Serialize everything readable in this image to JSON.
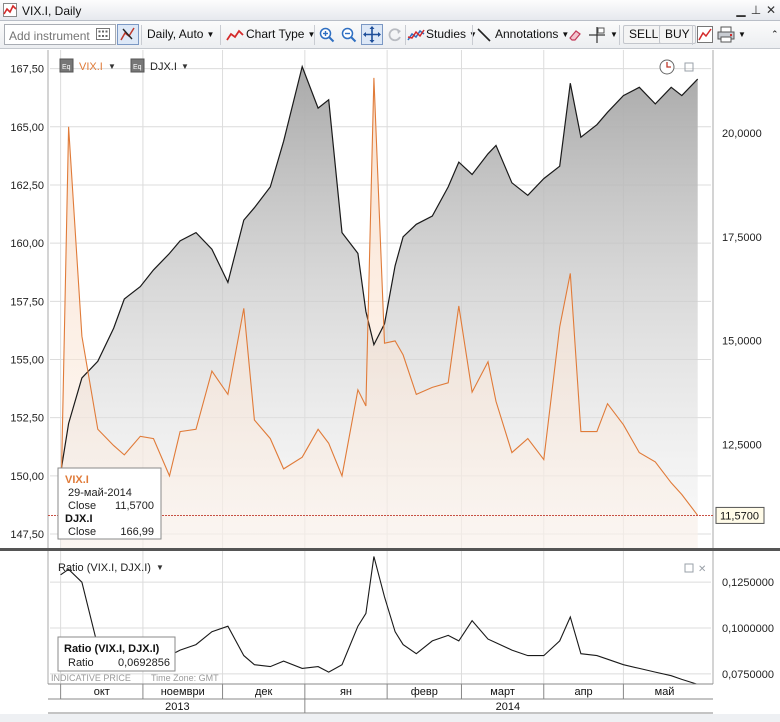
{
  "window": {
    "title": "VIX.I, Daily"
  },
  "toolbar": {
    "add_instrument_placeholder": "Add instrument",
    "period_label": "Daily,",
    "scale_label": "Auto",
    "chart_type_label": "Chart Type",
    "studies_label": "Studies",
    "annotations_label": "Annotations",
    "sell_label": "SELL",
    "buy_label": "BUY"
  },
  "legend": {
    "vix_label": "VIX.I",
    "djx_label": "DJX.I"
  },
  "tooltip": {
    "vix_title": "VIX.I",
    "date": "29-май-2014",
    "vix_close_label": "Close",
    "vix_close_value": "11,5700",
    "djx_title": "DJX.I",
    "djx_close_label": "Close",
    "djx_close_value": "166,99"
  },
  "price_marker": "11,5700",
  "lower_panel": {
    "title": "Ratio (VIX.I, DJX.I)",
    "tooltip_title": "Ratio (VIX.I, DJX.I)",
    "tooltip_label": "Ratio",
    "tooltip_value": "0,0692856",
    "indicative": "INDICATIVE PRICE",
    "timezone": "Time Zone: GMT"
  },
  "colors": {
    "vix": "#e07b39",
    "djx": "#1a1a1a",
    "ratio": "#1a1a1a",
    "background": "#ffffff"
  },
  "chart_data": {
    "type": "line",
    "x": [
      "2013-10-01",
      "2013-10-04",
      "2013-10-09",
      "2013-10-15",
      "2013-10-21",
      "2013-10-25",
      "2013-10-31",
      "2013-11-05",
      "2013-11-11",
      "2013-11-15",
      "2013-11-21",
      "2013-11-27",
      "2013-12-03",
      "2013-12-09",
      "2013-12-13",
      "2013-12-19",
      "2013-12-24",
      "2013-12-31",
      "2014-01-06",
      "2014-01-10",
      "2014-01-15",
      "2014-01-21",
      "2014-01-24",
      "2014-01-27",
      "2014-01-31",
      "2014-02-04",
      "2014-02-07",
      "2014-02-12",
      "2014-02-18",
      "2014-02-24",
      "2014-02-28",
      "2014-03-05",
      "2014-03-11",
      "2014-03-14",
      "2014-03-20",
      "2014-03-26",
      "2014-04-01",
      "2014-04-07",
      "2014-04-11",
      "2014-04-15",
      "2014-04-21",
      "2014-04-25",
      "2014-05-01",
      "2014-05-07",
      "2014-05-13",
      "2014-05-19",
      "2014-05-23",
      "2014-05-29"
    ],
    "series": [
      {
        "name": "VIX.I",
        "axis": "left",
        "values": [
          148.2,
          165.0,
          156.0,
          152.0,
          151.3,
          150.9,
          151.7,
          151.6,
          150.0,
          151.9,
          152.0,
          154.5,
          153.5,
          157.2,
          152.4,
          151.6,
          150.3,
          150.8,
          152.0,
          151.4,
          150.0,
          153.7,
          153.0,
          167.1,
          155.7,
          155.8,
          155.2,
          153.5,
          153.8,
          154.0,
          157.3,
          153.6,
          154.9,
          153.2,
          151.0,
          151.6,
          150.7,
          156.4,
          158.7,
          151.9,
          151.9,
          153.1,
          152.2,
          151.0,
          150.6,
          149.7,
          149.2,
          148.3
        ]
      },
      {
        "name": "DJX.I",
        "axis": "right",
        "values": [
          11800,
          13000,
          14100,
          14500,
          15300,
          16000,
          16300,
          16700,
          17100,
          17400,
          17600,
          17200,
          16400,
          17900,
          18200,
          18700,
          19800,
          21600,
          20600,
          20800,
          17600,
          17100,
          15700,
          14900,
          15400,
          16800,
          17500,
          17800,
          18000,
          18700,
          19300,
          19000,
          19500,
          19700,
          18800,
          18500,
          18900,
          19200,
          21200,
          19900,
          20200,
          20500,
          20900,
          21100,
          20700,
          21100,
          20900,
          21300
        ]
      },
      {
        "name": "Ratio (VIX.I, DJX.I)",
        "axis": "lower",
        "values": [
          0.129,
          0.132,
          0.125,
          0.09,
          0.085,
          0.082,
          0.08,
          0.083,
          0.085,
          0.088,
          0.091,
          0.098,
          0.101,
          0.085,
          0.08,
          0.079,
          0.082,
          0.078,
          0.079,
          0.076,
          0.08,
          0.101,
          0.108,
          0.139,
          0.117,
          0.098,
          0.091,
          0.086,
          0.093,
          0.096,
          0.093,
          0.104,
          0.094,
          0.092,
          0.088,
          0.085,
          0.085,
          0.093,
          0.106,
          0.086,
          0.085,
          0.083,
          0.08,
          0.078,
          0.076,
          0.074,
          0.072,
          0.0693
        ]
      }
    ],
    "left_axis": {
      "ticks": [
        "147,50",
        "150,00",
        "152,50",
        "155,00",
        "157,50",
        "160,00",
        "162,50",
        "165,00",
        "167,50"
      ],
      "ylim": [
        146.9,
        168.3
      ]
    },
    "right_axis": {
      "ticks": [
        "12,5000",
        "15,0000",
        "17,5000",
        "20,0000"
      ],
      "ylim": [
        10000,
        22000
      ]
    },
    "lower_axis": {
      "ticks": [
        "0,0750000",
        "0,1000000",
        "0,1250000"
      ],
      "ylim": [
        0.0695,
        0.142
      ]
    },
    "month_labels": [
      "окт",
      "ноември",
      "дек",
      "ян",
      "февр",
      "март",
      "апр",
      "май"
    ],
    "year_labels": [
      "2013",
      "2014"
    ]
  }
}
